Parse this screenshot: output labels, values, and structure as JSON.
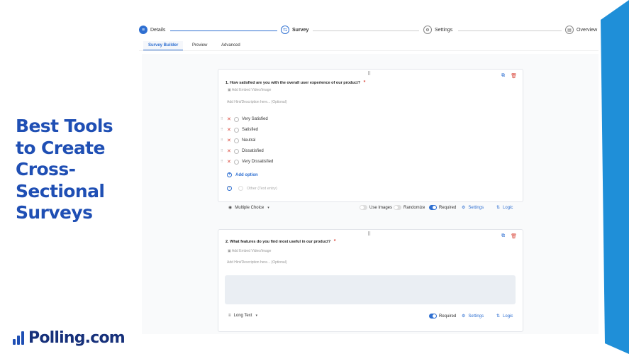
{
  "banner": {
    "headline_lines": [
      "Best Tools",
      "to Create",
      "Cross-",
      "Sectional",
      "Surveys"
    ],
    "logo_text": "Polling.com",
    "accent_color": "#1f4fb4"
  },
  "stepper": {
    "steps": [
      {
        "label": "Details",
        "icon": "list-icon"
      },
      {
        "label": "Survey",
        "icon": "survey-icon"
      },
      {
        "label": "Settings",
        "icon": "gear-icon"
      },
      {
        "label": "Overview",
        "icon": "document-icon"
      }
    ]
  },
  "tabs": [
    "Survey Builder",
    "Preview",
    "Advanced"
  ],
  "questions": [
    {
      "number": "1.",
      "text": "How satisfied are you with the overall user experience of our product?",
      "required_mark": "*",
      "media_label": "Add Embed Video/Image",
      "hint": "Add Hint/Description here... (Optional)",
      "options": [
        "Very Satisfied",
        "Satisfied",
        "Neutral",
        "Dissatisfied",
        "Very Dissatisfied"
      ],
      "add_option": "Add option",
      "other_option": "Other (Text entry)",
      "type_label": "Multiple Choice",
      "use_images": "Use Images",
      "randomize": "Randomize",
      "required": "Required",
      "settings": "Settings",
      "logic": "Logic"
    },
    {
      "number": "2.",
      "text": "What features do you find most useful in our product?",
      "required_mark": "*",
      "media_label": "Add Embed Video/Image",
      "hint": "Add Hint/Description here... (Optional)",
      "type_label": "Long Text",
      "required": "Required",
      "settings": "Settings",
      "logic": "Logic"
    }
  ]
}
